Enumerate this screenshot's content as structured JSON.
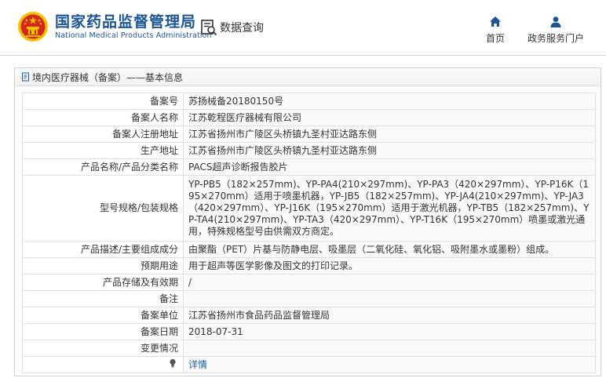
{
  "header": {
    "logo_cn": "国家药品监督管理局",
    "logo_en": "National Medical Products Administration",
    "query_label": "数据查询",
    "nav": [
      {
        "label": "首页",
        "icon": "home-icon"
      },
      {
        "label": "政务服务门户",
        "icon": "user-icon"
      }
    ]
  },
  "breadcrumb": {
    "text": "境内医疗器械（备案）——基本信息",
    "icon": "document-icon"
  },
  "rows": [
    {
      "label": "备案号",
      "value": "苏扬械备20180150号"
    },
    {
      "label": "备案人名称",
      "value": "江苏乾程医疗器械有限公司"
    },
    {
      "label": "备案人注册地址",
      "value": "江苏省扬州市广陵区头桥镇九圣村亚达路东侧"
    },
    {
      "label": "生产地址",
      "value": "江苏省扬州市广陵区头桥镇九圣村亚达路东侧"
    },
    {
      "label": "产品名称/产品分类名称",
      "value": "PACS超声诊断报告胶片"
    },
    {
      "label": "型号规格/包装规格",
      "value": "YP-PB5（182×257mm)、YP-PA4(210×297mm)、YP-PA3（420×297mm）、YP-P16K（195×270mm）适用于喷墨机器，YP-JB5（182×257mm)、YP-JA4(210×297mm)、YP-JA3（420×297mm）、YP-J16K（195×270mm）适用于激光机器，YP-TB5（182×257mm)、YP-TA4(210×297mm)、YP-TA3（420×297mm）、YP-T16K（195×270mm）喷墨或激光通用，特殊规格型号由供需双方商定。"
    },
    {
      "label": "产品描述/主要组成成分",
      "value": "由聚酯（PET）片基与防静电层、吸墨层（二氧化硅、氧化铝、吸附墨水或墨粉）组成。"
    },
    {
      "label": "预期用途",
      "value": "用于超声等医学影像及图文的打印记录。"
    },
    {
      "label": "产品存储及有效期",
      "value": "/"
    },
    {
      "label": "备注",
      "value": ""
    },
    {
      "label": "备案单位",
      "value": "江苏省扬州市食品药品监督管理局"
    },
    {
      "label": "备案日期",
      "value": "2018-07-31"
    },
    {
      "label": "变更情况",
      "value": ""
    }
  ],
  "detail_row": {
    "icon": "lightbulb-icon",
    "link": "详情"
  },
  "colors": {
    "brand_blue": "#1b5596",
    "link_blue": "#1b5faa",
    "emblem_red": "#d7261c",
    "emblem_gold": "#f2c200"
  }
}
